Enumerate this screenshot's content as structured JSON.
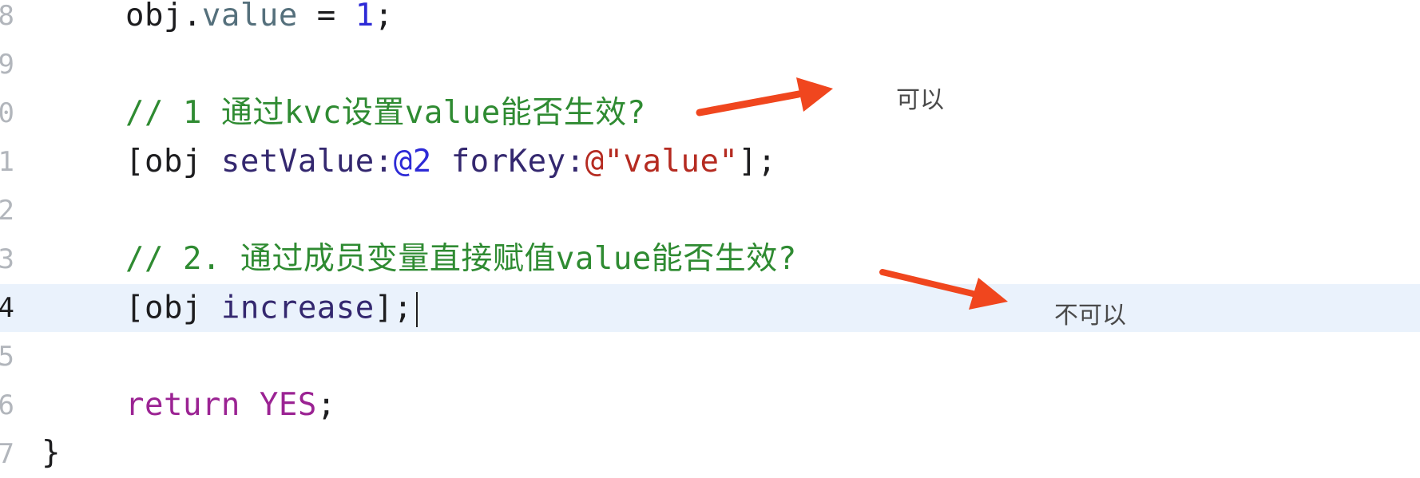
{
  "editor": {
    "lines": [
      {
        "number": "8",
        "current": false,
        "tokens": [
          {
            "text": "obj.",
            "cls": ""
          },
          {
            "text": "value",
            "cls": "tok-prop"
          },
          {
            "text": " = ",
            "cls": ""
          },
          {
            "text": "1",
            "cls": "tok-num"
          },
          {
            "text": ";",
            "cls": ""
          }
        ]
      },
      {
        "number": "9",
        "current": false,
        "tokens": []
      },
      {
        "number": "0",
        "current": false,
        "tokens": [
          {
            "text": "// 1 通过kvc设置value能否生效?",
            "cls": "tok-comment"
          }
        ]
      },
      {
        "number": "1",
        "current": false,
        "tokens": [
          {
            "text": "[obj ",
            "cls": ""
          },
          {
            "text": "setValue:",
            "cls": "tok-method"
          },
          {
            "text": "@2",
            "cls": "tok-num"
          },
          {
            "text": " ",
            "cls": ""
          },
          {
            "text": "forKey:",
            "cls": "tok-method"
          },
          {
            "text": "@\"value\"",
            "cls": "tok-str"
          },
          {
            "text": "];",
            "cls": ""
          }
        ]
      },
      {
        "number": "2",
        "current": false,
        "tokens": []
      },
      {
        "number": "3",
        "current": false,
        "tokens": [
          {
            "text": "// 2. 通过成员变量直接赋值value能否生效?",
            "cls": "tok-comment"
          }
        ]
      },
      {
        "number": "4",
        "current": true,
        "tokens": [
          {
            "text": "[obj ",
            "cls": ""
          },
          {
            "text": "increase",
            "cls": "tok-method"
          },
          {
            "text": "];",
            "cls": ""
          }
        ]
      },
      {
        "number": "5",
        "current": false,
        "tokens": []
      },
      {
        "number": "6",
        "current": false,
        "tokens": [
          {
            "text": "return",
            "cls": "tok-kw"
          },
          {
            "text": " ",
            "cls": ""
          },
          {
            "text": "YES",
            "cls": "tok-kw"
          },
          {
            "text": ";",
            "cls": ""
          }
        ]
      },
      {
        "number": "7",
        "current": false,
        "tokens": []
      }
    ],
    "closing_brace": "}"
  },
  "annotations": {
    "first": "可以",
    "second": "不可以"
  },
  "colors": {
    "arrow": "#f0461e",
    "current_line_bg": "#eaf2fc",
    "comment": "#2f8b32",
    "keyword": "#9b2393",
    "string": "#b52b21",
    "number": "#2d2ad6"
  }
}
